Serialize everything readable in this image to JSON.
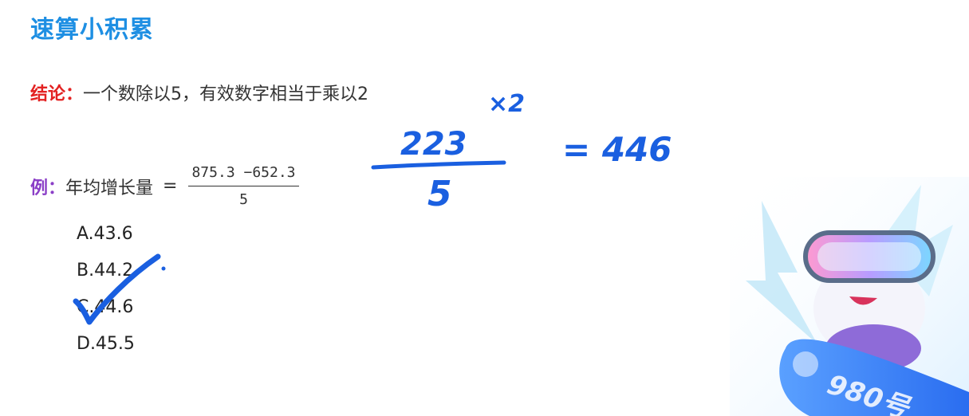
{
  "title": "速算小积累",
  "conclusion": {
    "label": "结论：",
    "text": "一个数除以5，有效数字相当于乘以2"
  },
  "example": {
    "label": "例：",
    "text": "年均增长量",
    "equals": "=",
    "numerator": "875.3 −652.3",
    "denominator": "5"
  },
  "options": [
    "A.43.6",
    "B.44.2",
    "C.44.6",
    "D.45.5"
  ],
  "handwriting": {
    "multiplier": "×2",
    "numerator": "223",
    "denominator": "5",
    "result": "= 446"
  },
  "mascot": {
    "badge": "980号"
  },
  "colors": {
    "title": "#1e8fe3",
    "conclusion_label": "#e32222",
    "example_label": "#8b3fc7",
    "ink": "#1a5fe0"
  }
}
